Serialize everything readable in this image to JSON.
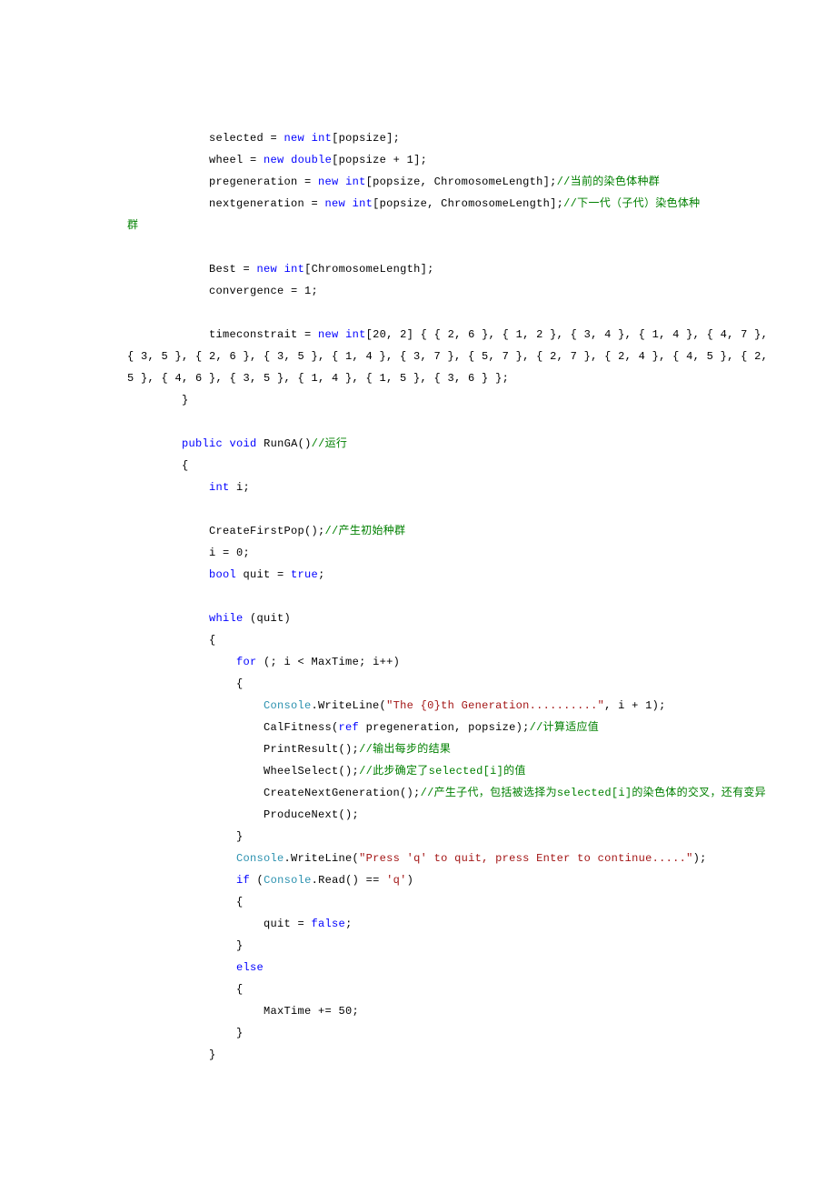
{
  "l1a": "            selected = ",
  "l1b": "new",
  "l1c": " ",
  "l1d": "int",
  "l1e": "[popsize];",
  "l2a": "            wheel = ",
  "l2b": "new",
  "l2c": " ",
  "l2d": "double",
  "l2e": "[popsize + 1];",
  "l3a": "            pregeneration = ",
  "l3b": "new",
  "l3c": " ",
  "l3d": "int",
  "l3e": "[popsize, ChromosomeLength];",
  "l3f": "//当前的染色体种群",
  "l4a": "            nextgeneration = ",
  "l4b": "new",
  "l4c": " ",
  "l4d": "int",
  "l4e": "[popsize, ChromosomeLength];",
  "l4f": "//下一代（子代）染色体种群",
  "l5": " ",
  "l6a": "            Best = ",
  "l6b": "new",
  "l6c": " ",
  "l6d": "int",
  "l6e": "[ChromosomeLength];",
  "l7": "            convergence = 1;",
  "l8": " ",
  "l9a": "            timeconstrait = ",
  "l9b": "new",
  "l9c": " ",
  "l9d": "int",
  "l9e": "[20, 2] { { 2, 6 }, { 1, 2 }, { 3, 4 }, { 1, 4 }, { 4, 7 }, { 3, 5 }, { 2, 6 }, { 3, 5 }, { 1, 4 }, { 3, 7 }, { 5, 7 }, { 2, 7 }, { 2, 4 }, { 4, 5 }, { 2, 5 }, { 4, 6 }, { 3, 5 }, { 1, 4 }, { 1, 5 }, { 3, 6 } };",
  "l10": "        }",
  "l11": " ",
  "l12a": "        ",
  "l12b": "public",
  "l12c": " ",
  "l12d": "void",
  "l12e": " RunGA()",
  "l12f": "//运行",
  "l13": "        {",
  "l14a": "            ",
  "l14b": "int",
  "l14c": " i;",
  "l15": " ",
  "l16a": "            CreateFirstPop();",
  "l16b": "//产生初始种群",
  "l17": "            i = 0;",
  "l18a": "            ",
  "l18b": "bool",
  "l18c": " quit = ",
  "l18d": "true",
  "l18e": ";",
  "l19": " ",
  "l20a": "            ",
  "l20b": "while",
  "l20c": " (quit)",
  "l21": "            {",
  "l22a": "                ",
  "l22b": "for",
  "l22c": " (; i < MaxTime; i++)",
  "l23": "                {",
  "l24a": "                    ",
  "l24b": "Console",
  "l24c": ".WriteLine(",
  "l24d": "\"The {0}th Generation..........\"",
  "l24e": ", i + 1);",
  "l25a": "                    CalFitness(",
  "l25b": "ref",
  "l25c": " pregeneration, popsize);",
  "l25d": "//计算适应值",
  "l26a": "                    PrintResult();",
  "l26b": "//输出每步的结果",
  "l27a": "                    WheelSelect();",
  "l27b": "//此步确定了selected[i]的值",
  "l28a": "                    CreateNextGeneration();",
  "l28b": "//产生子代，包括被选择为selected[i]的染色体的交叉，还有变异",
  "l29": "                    ProduceNext();",
  "l30": "                }",
  "l31a": "                ",
  "l31b": "Console",
  "l31c": ".WriteLine(",
  "l31d": "\"Press 'q' to quit, press Enter to continue.....\"",
  "l31e": ");",
  "l32a": "                ",
  "l32b": "if",
  "l32c": " (",
  "l32d": "Console",
  "l32e": ".Read() == ",
  "l32f": "'q'",
  "l32g": ")",
  "l33": "                {",
  "l34a": "                    quit = ",
  "l34b": "false",
  "l34c": ";",
  "l35": "                }",
  "l36a": "                ",
  "l36b": "else",
  "l37": "                {",
  "l38": "                    MaxTime += 50;",
  "l39": "                }",
  "l40": "            }"
}
